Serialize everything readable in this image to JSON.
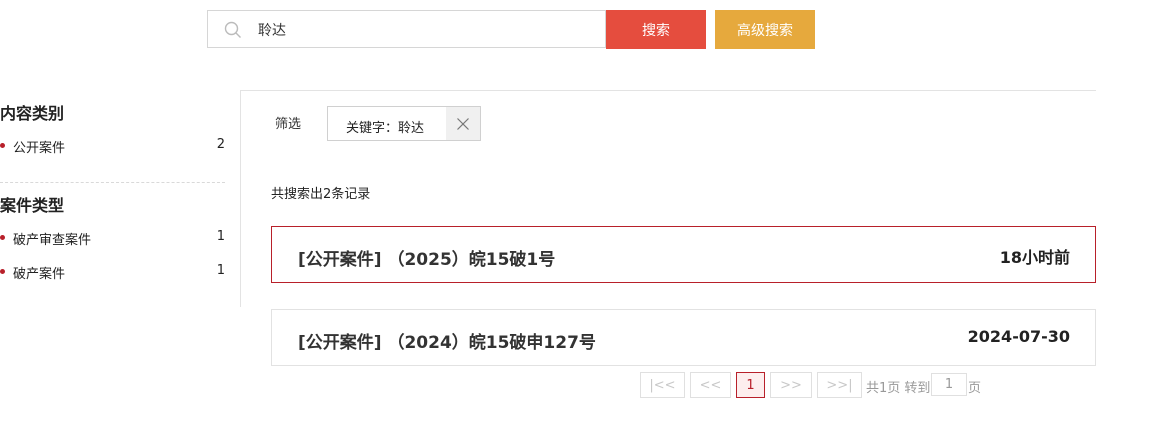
{
  "search": {
    "value": "聆达",
    "search_button": "搜索",
    "advanced_button": "高级搜索"
  },
  "sidebar": {
    "sections": [
      {
        "heading": "内容类别",
        "items": [
          {
            "label": "公开案件",
            "count": "2"
          }
        ]
      },
      {
        "heading": "案件类型",
        "items": [
          {
            "label": "破产审查案件",
            "count": "1"
          },
          {
            "label": "破产案件",
            "count": "1"
          }
        ]
      }
    ]
  },
  "filter": {
    "label": "筛选",
    "tag": "关键字：聆达"
  },
  "result_count": "共搜索出2条记录",
  "results": [
    {
      "title": "[公开案件] （2025）皖15破1号",
      "time": "18小时前"
    },
    {
      "title": "[公开案件] （2024）皖15破申127号",
      "time": "2024-07-30"
    }
  ],
  "pagination": {
    "first": "|<<",
    "prev": "<<",
    "current": "1",
    "next": ">>",
    "last": ">>|",
    "total_text": "共1页 转到",
    "goto_value": "1",
    "page_unit": "页"
  },
  "colors": {
    "search_button": "#e54d3e",
    "advanced_button": "#e6a93d",
    "accent": "#b8202a"
  }
}
